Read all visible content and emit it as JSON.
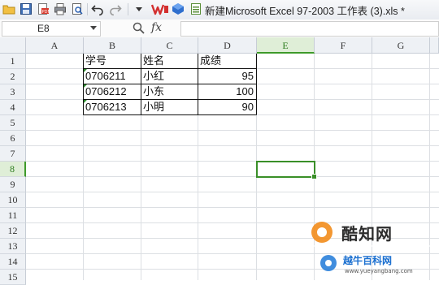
{
  "toolbar": {
    "icons": [
      "folder-open-icon",
      "save-icon",
      "export-pdf-icon",
      "print-icon",
      "print-preview-icon",
      "undo-icon",
      "redo-icon",
      "more-dropdown-icon",
      "wps-logo-icon",
      "cloud-icon"
    ],
    "document_title": "新建Microsoft Excel 97-2003 工作表 (3).xls *"
  },
  "formula_bar": {
    "name_box": "E8",
    "fx_label": "fx",
    "formula": ""
  },
  "columns": [
    "A",
    "B",
    "C",
    "D",
    "E",
    "F",
    "G"
  ],
  "rows": [
    "1",
    "2",
    "3",
    "4",
    "5",
    "6",
    "7",
    "8",
    "9",
    "10",
    "11",
    "12",
    "13",
    "14",
    "15"
  ],
  "active_cell": "E8",
  "sheet": {
    "headers": {
      "id": "学号",
      "name": "姓名",
      "score": "成绩"
    },
    "records": [
      {
        "id": "0706211",
        "name": "小红",
        "score": "95"
      },
      {
        "id": "0706212",
        "name": "小东",
        "score": "100"
      },
      {
        "id": "0706213",
        "name": "小明",
        "score": "90"
      }
    ]
  },
  "watermark": {
    "brand": "酷知网",
    "sub": "越牛百科网",
    "url": "www.yueyangbang.com"
  },
  "colors": {
    "selection": "#3a8f28",
    "active_header_bg": "#dfeed7",
    "header_bg": "#eef1f5"
  }
}
